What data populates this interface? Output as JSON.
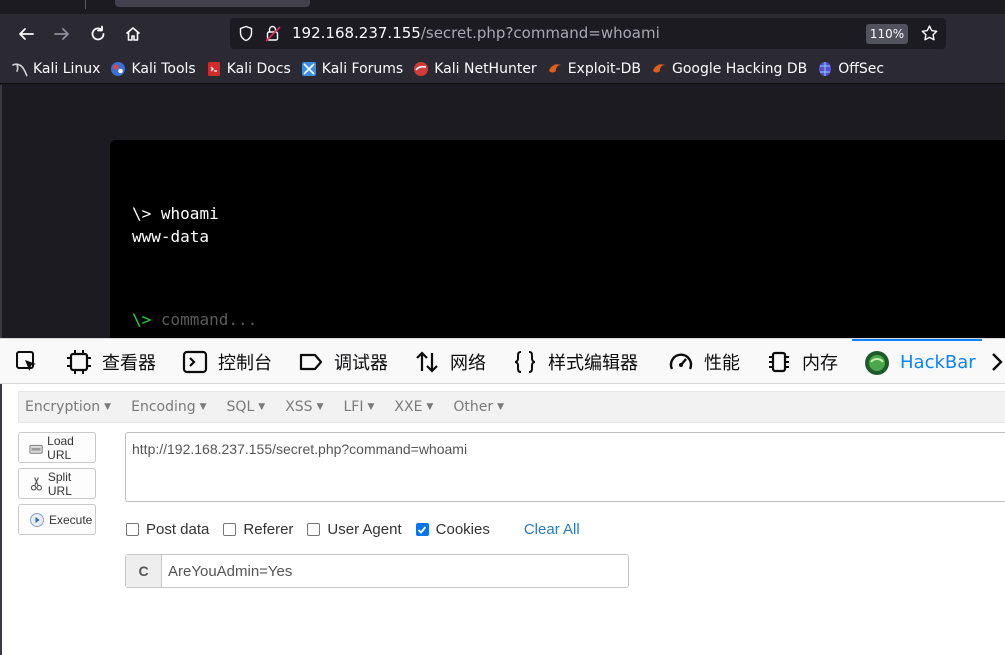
{
  "browser": {
    "url_host": "192.168.237.155",
    "url_rest": "/secret.php?command=whoami",
    "zoom": "110%"
  },
  "bookmarks": [
    {
      "label": "Kali Linux",
      "icon": "kali-dragon-icon",
      "color": "#cfcfcf"
    },
    {
      "label": "Kali Tools",
      "icon": "kali-tools-icon",
      "color": "#3b6fd8"
    },
    {
      "label": "Kali Docs",
      "icon": "kali-docs-icon",
      "color": "#d42a2a"
    },
    {
      "label": "Kali Forums",
      "icon": "kali-forums-icon",
      "color": "#3b8fe0"
    },
    {
      "label": "Kali NetHunter",
      "icon": "nethunter-icon",
      "color": "#d43a3a"
    },
    {
      "label": "Exploit-DB",
      "icon": "exploit-db-icon",
      "color": "#e35c1c"
    },
    {
      "label": "Google Hacking DB",
      "icon": "ghdb-icon",
      "color": "#e35c1c"
    },
    {
      "label": "OffSec",
      "icon": "offsec-icon",
      "color": "#6a5bd8"
    }
  ],
  "terminal": {
    "prompt": "\\>",
    "command": "whoami",
    "output": "www-data",
    "input_placeholder": "command..."
  },
  "devtools": {
    "tabs": [
      {
        "label": "查看器",
        "icon": "inspector-icon"
      },
      {
        "label": "控制台",
        "icon": "console-icon"
      },
      {
        "label": "调试器",
        "icon": "debugger-icon"
      },
      {
        "label": "网络",
        "icon": "network-icon"
      },
      {
        "label": "样式编辑器",
        "icon": "style-editor-icon"
      },
      {
        "label": "性能",
        "icon": "performance-icon"
      },
      {
        "label": "内存",
        "icon": "memory-icon"
      },
      {
        "label": "HackBar",
        "icon": "hackbar-icon"
      }
    ],
    "active": "HackBar"
  },
  "hackbar": {
    "menus": [
      "Encryption",
      "Encoding",
      "SQL",
      "XSS",
      "LFI",
      "XXE",
      "Other"
    ],
    "buttons": {
      "load": "Load URL",
      "split": "Split URL",
      "execute": "Execute"
    },
    "url_value": "http://192.168.237.155/secret.php?command=whoami",
    "options": {
      "post": "Post data",
      "referer": "Referer",
      "useragent": "User Agent",
      "cookies": "Cookies",
      "clear": "Clear All"
    },
    "cookie_label": "C",
    "cookie_value": "AreYouAdmin=Yes"
  },
  "colors": {
    "accent": "#0a84ff",
    "terminal_prompt": "#2bd82b",
    "checkbox_on": "#0a74f0"
  }
}
